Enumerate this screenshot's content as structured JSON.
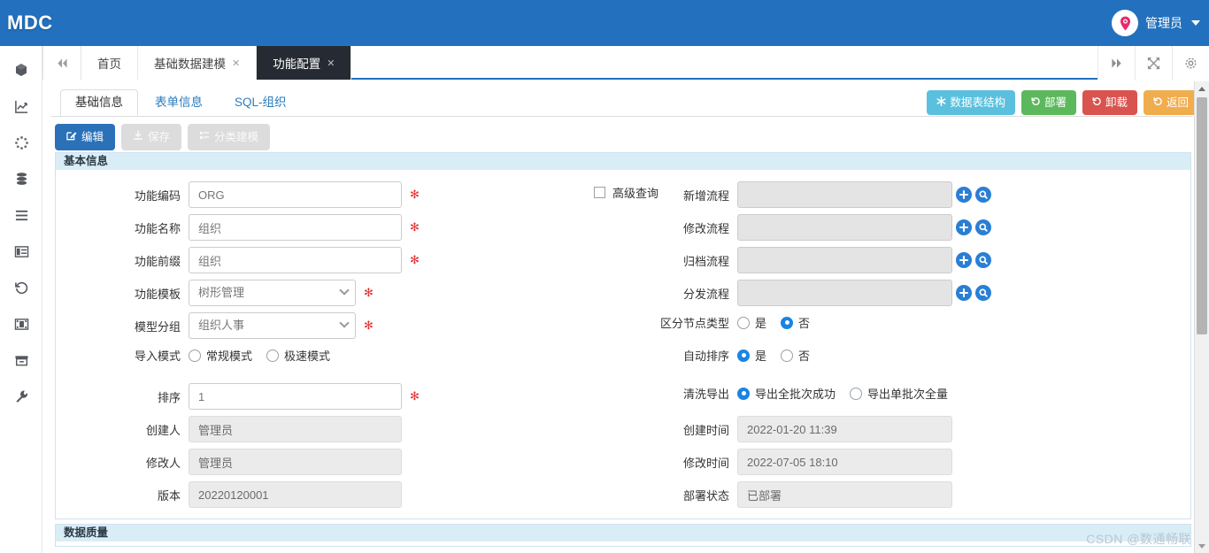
{
  "header": {
    "brand": "MDC",
    "user_name": "管理员",
    "avatar_icon": "location-pin-icon",
    "caret_icon": "caret-down-icon",
    "brand_color": "#2371be",
    "avatar_color": "#e8286f"
  },
  "tabbar": {
    "nav_left_icon": "double-chevron-left-icon",
    "tabs": [
      {
        "label": "首页",
        "closable": false,
        "active": false
      },
      {
        "label": "基础数据建模",
        "closable": true,
        "active": false
      },
      {
        "label": "功能配置",
        "closable": true,
        "active": true
      }
    ],
    "close_glyph": "✕",
    "right_buttons": [
      {
        "icon": "double-chevron-right-icon",
        "name": "tab-scroll-right-button"
      },
      {
        "icon": "expand-arrows-icon",
        "name": "fullscreen-button"
      },
      {
        "icon": "gear-icon",
        "name": "settings-button"
      }
    ]
  },
  "rail": {
    "items": [
      {
        "icon": "cube-icon",
        "name": "sidebar-item-cube"
      },
      {
        "icon": "chart-line-icon",
        "name": "sidebar-item-analytics"
      },
      {
        "icon": "spinner-dots-icon",
        "name": "sidebar-item-process"
      },
      {
        "icon": "database-icon",
        "name": "sidebar-item-database"
      },
      {
        "icon": "list-icon",
        "name": "sidebar-item-list"
      },
      {
        "icon": "table-icon",
        "name": "sidebar-item-table"
      },
      {
        "icon": "history-icon",
        "name": "sidebar-item-history"
      },
      {
        "icon": "film-icon",
        "name": "sidebar-item-media"
      },
      {
        "icon": "archive-icon",
        "name": "sidebar-item-archive"
      },
      {
        "icon": "wrench-icon",
        "name": "sidebar-item-tools"
      }
    ]
  },
  "subtabs": [
    {
      "label": "基础信息",
      "active": true
    },
    {
      "label": "表单信息",
      "active": false
    },
    {
      "label": "SQL-组织",
      "active": false
    }
  ],
  "top_actions": [
    {
      "label": "数据表结构",
      "icon": "asterisk-icon",
      "color": "#5bc0de",
      "style": "blue"
    },
    {
      "label": "部署",
      "icon": "undo-icon",
      "color": "#5cb85c",
      "style": "green"
    },
    {
      "label": "卸载",
      "icon": "undo-icon",
      "color": "#d9534f",
      "style": "red"
    },
    {
      "label": "返回",
      "icon": "undo-icon",
      "color": "#f0ad4e",
      "style": "orange"
    }
  ],
  "toolbar": [
    {
      "label": "编辑",
      "icon": "edit-icon",
      "enabled": true
    },
    {
      "label": "保存",
      "icon": "download-icon",
      "enabled": false
    },
    {
      "label": "分类建模",
      "icon": "list-icon",
      "enabled": false
    }
  ],
  "panels": {
    "basic_title": "基本信息",
    "quality_title": "数据质量"
  },
  "form": {
    "left": {
      "code_label": "功能编码",
      "code_value": "ORG",
      "name_label": "功能名称",
      "name_value": "组织",
      "prefix_label": "功能前缀",
      "prefix_value": "组织",
      "template_label": "功能模板",
      "template_value": "树形管理",
      "group_label": "模型分组",
      "group_value": "组织人事",
      "import_label": "导入模式",
      "import_options": [
        {
          "label": "常规模式",
          "selected": false
        },
        {
          "label": "极速模式",
          "selected": false
        }
      ],
      "sort_label": "排序",
      "sort_value": "1",
      "creator_label": "创建人",
      "creator_value": "管理员",
      "modifier_label": "修改人",
      "modifier_value": "管理员",
      "version_label": "版本",
      "version_value": "20220120001"
    },
    "right": {
      "advanced_query_label": "高级查询",
      "advanced_query_checked": false,
      "flows": [
        {
          "label": "新增流程",
          "value": ""
        },
        {
          "label": "修改流程",
          "value": ""
        },
        {
          "label": "归档流程",
          "value": ""
        },
        {
          "label": "分发流程",
          "value": ""
        }
      ],
      "add_icon": "plus-circle-icon",
      "search_icon": "search-circle-icon",
      "node_type_label": "区分节点类型",
      "node_type_options": [
        {
          "label": "是",
          "selected": false
        },
        {
          "label": "否",
          "selected": true
        }
      ],
      "auto_sort_label": "自动排序",
      "auto_sort_options": [
        {
          "label": "是",
          "selected": true
        },
        {
          "label": "否",
          "selected": false
        }
      ],
      "clean_export_label": "清洗导出",
      "clean_export_options": [
        {
          "label": "导出全批次成功",
          "selected": true
        },
        {
          "label": "导出单批次全量",
          "selected": false
        }
      ],
      "create_time_label": "创建时间",
      "create_time_value": "2022-01-20 11:39",
      "modify_time_label": "修改时间",
      "modify_time_value": "2022-07-05 18:10",
      "deploy_status_label": "部署状态",
      "deploy_status_value": "已部署"
    }
  },
  "watermark": "CSDN @数通畅联"
}
